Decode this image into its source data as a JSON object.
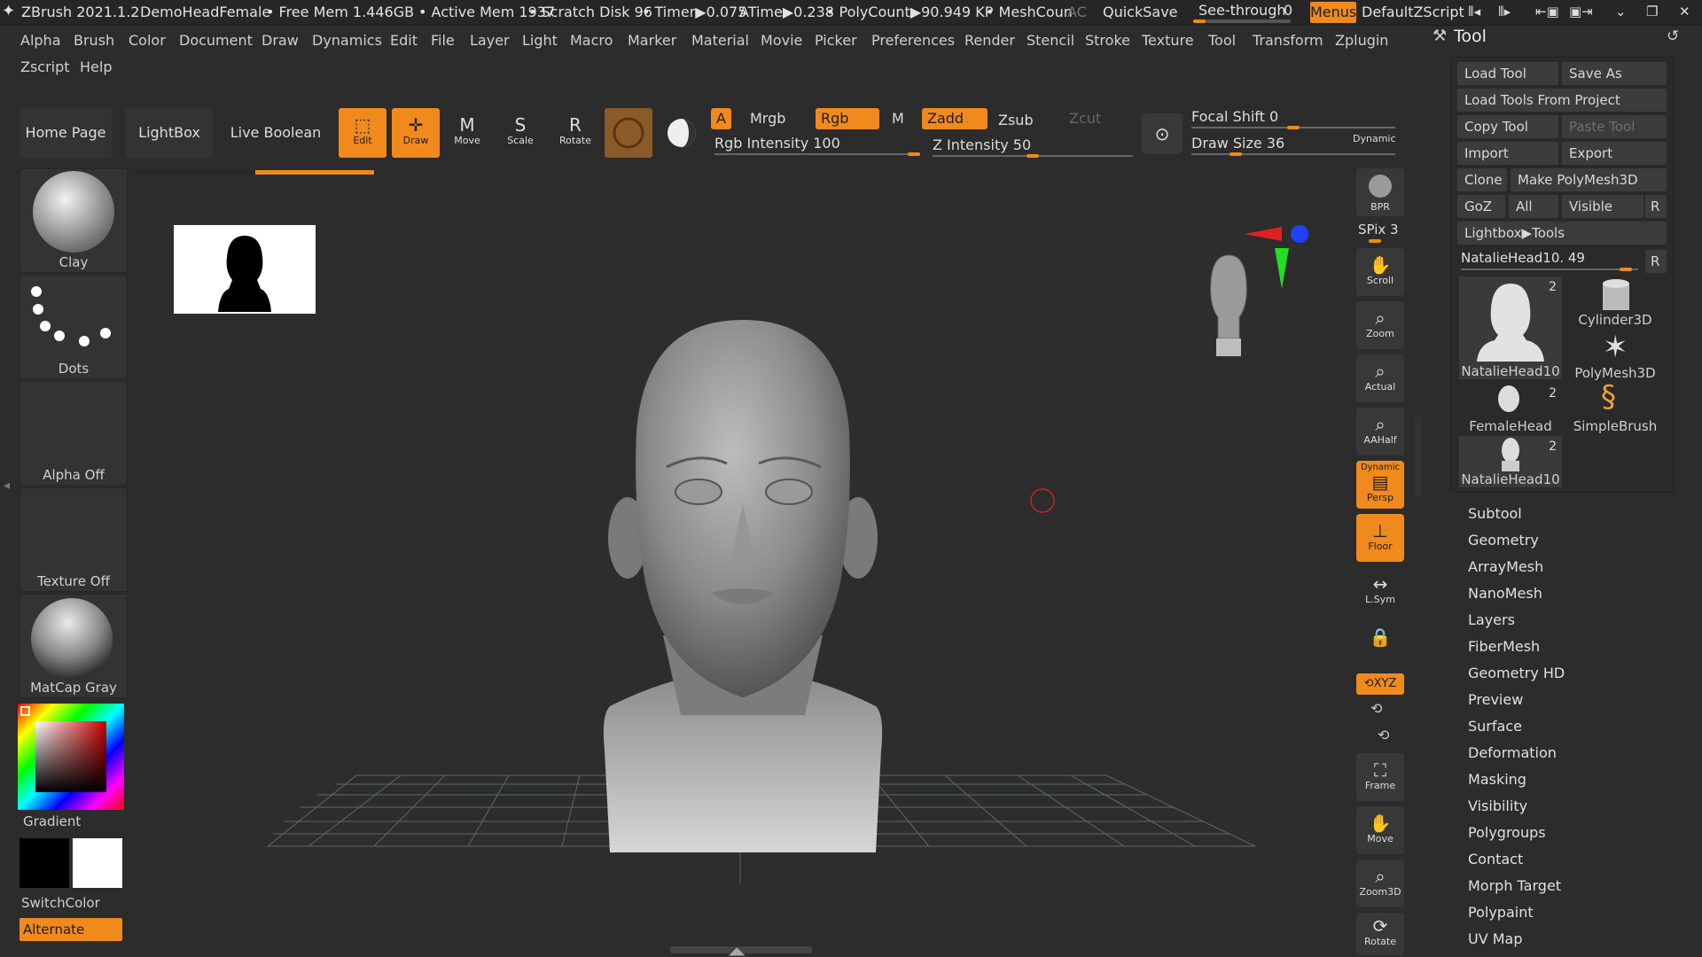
{
  "titlebar": {
    "app": "ZBrush 2021.1.2",
    "document": "DemoHeadFemale",
    "free_mem": "• Free Mem 1.446GB",
    "active_mem": "• Active Mem 1937",
    "scratch": "• Scratch Disk 96",
    "timer": "• Timer▶0.075",
    "atime": "ATime▶0.238",
    "polycount": "• PolyCount▶90.949 KP",
    "meshcount": "• MeshCoun",
    "ac": "AC",
    "quicksave": "QuickSave",
    "see_through_label": "See-through",
    "see_through_value": "0",
    "menus": "Menus",
    "script": "DefaultZScript"
  },
  "menubar": [
    "Alpha",
    "Brush",
    "Color",
    "Document",
    "Draw",
    "Dynamics",
    "Edit",
    "File",
    "Layer",
    "Light",
    "Macro",
    "Marker",
    "Material",
    "Movie",
    "Picker",
    "Preferences",
    "Render",
    "Stencil",
    "Stroke",
    "Texture",
    "Tool",
    "Transform",
    "Zplugin",
    "Zscript",
    "Help"
  ],
  "shelf": {
    "home_page": "Home Page",
    "lightbox": "LightBox",
    "live_boolean": "Live Boolean",
    "edit": "Edit",
    "draw": "Draw",
    "move": "Move",
    "scale": "Scale",
    "rotate": "Rotate",
    "a": "A",
    "mrgb": "Mrgb",
    "rgb": "Rgb",
    "m": "M",
    "zadd": "Zadd",
    "zsub": "Zsub",
    "zcut": "Zcut",
    "rgb_intensity": "Rgb Intensity 100",
    "z_intensity": "Z Intensity 50",
    "focal_shift": "Focal Shift 0",
    "draw_size": "Draw Size 36",
    "dynamic": "Dynamic",
    "rgb_intensity_level": 1.0,
    "z_intensity_level": 0.5,
    "focal_shift_level": 0.5,
    "draw_size_level": 0.2
  },
  "left_panel": {
    "brush": "Clay",
    "stroke": "Dots",
    "alpha": "Alpha Off",
    "texture": "Texture Off",
    "material": "MatCap Gray",
    "gradient": "Gradient",
    "switch_color": "SwitchColor",
    "alternate": "Alternate"
  },
  "nav": {
    "bpr": "BPR",
    "spix": "SPix 3",
    "scroll": "Scroll",
    "zoom": "Zoom",
    "actual": "Actual",
    "aahalf": "AAHalf",
    "persp_dynamic": "Dynamic",
    "persp": "Persp",
    "floor": "Floor",
    "lsym": "L.Sym",
    "xyz": "⟲XYZ",
    "frame": "Frame",
    "move": "Move",
    "zoom3d": "Zoom3D",
    "rotate": "Rotate"
  },
  "tool_palette": {
    "title": "Tool",
    "load_tool": "Load Tool",
    "save_as": "Save As",
    "load_from_project": "Load Tools From Project",
    "copy_tool": "Copy Tool",
    "paste_tool": "Paste Tool",
    "import": "Import",
    "export": "Export",
    "clone": "Clone",
    "make_polymesh": "Make PolyMesh3D",
    "goz": "GoZ",
    "all": "All",
    "visible": "Visible",
    "r": "R",
    "lightbox_tools": "Lightbox▶Tools",
    "current_tool": "NatalieHead10. 49",
    "current_tool_level": 0.96,
    "thumbs": [
      {
        "name": "NatalieHead10",
        "count": "2"
      },
      {
        "name": "Cylinder3D",
        "count": ""
      },
      {
        "name": "PolyMesh3D",
        "count": ""
      },
      {
        "name": "FemaleHead",
        "count": "2"
      },
      {
        "name": "SimpleBrush",
        "count": ""
      },
      {
        "name": "NatalieHead10",
        "count": "2"
      }
    ],
    "subpalettes": [
      "Subtool",
      "Geometry",
      "ArrayMesh",
      "NanoMesh",
      "Layers",
      "FiberMesh",
      "Geometry HD",
      "Preview",
      "Surface",
      "Deformation",
      "Masking",
      "Visibility",
      "Polygroups",
      "Contact",
      "Morph Target",
      "Polypaint",
      "UV Map"
    ]
  },
  "colors": {
    "accent": "#f08a1c",
    "background": "#2c2c2c",
    "panel": "#333333"
  }
}
